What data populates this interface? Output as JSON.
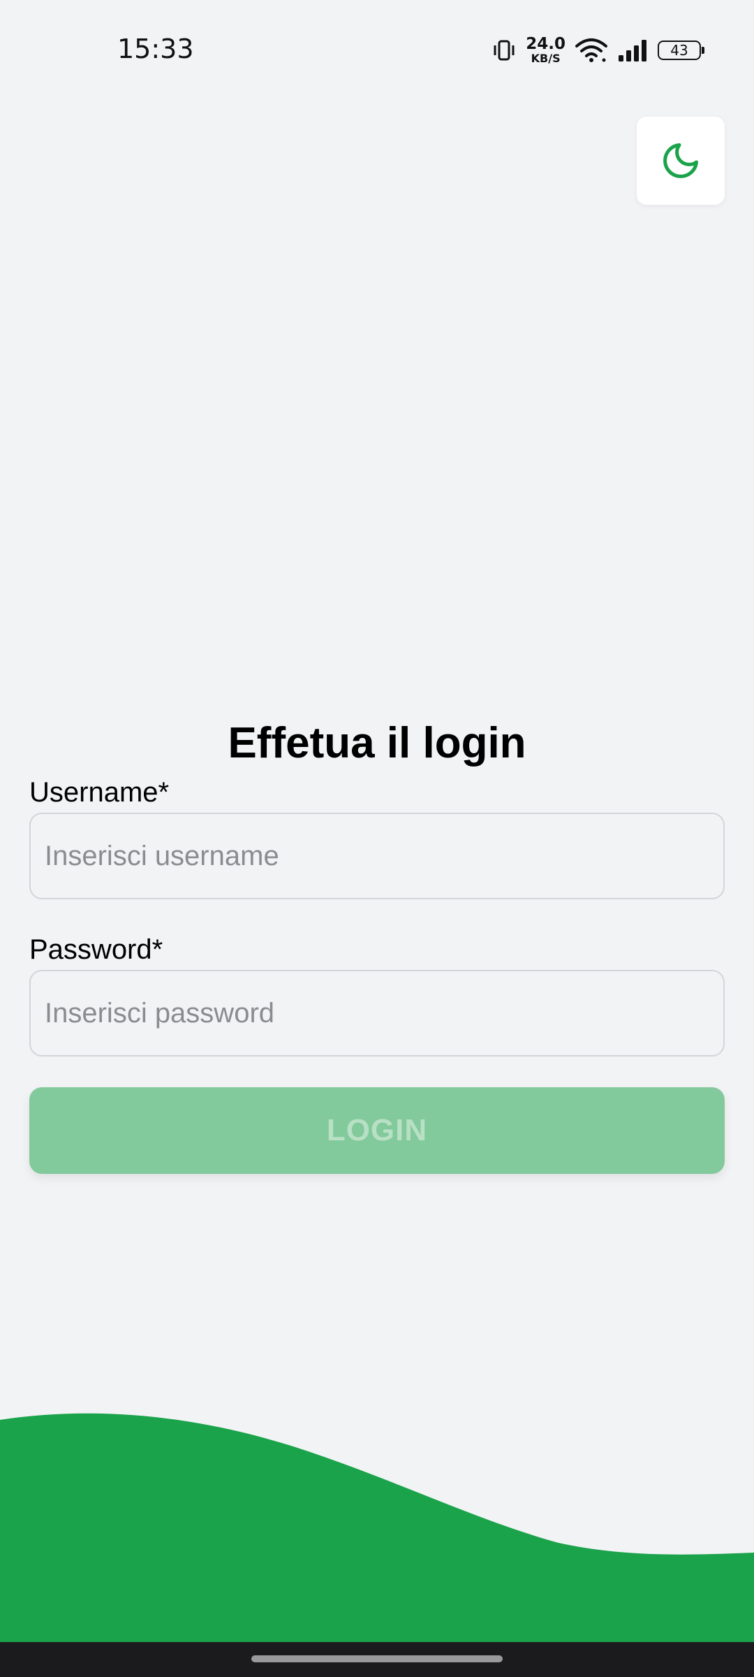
{
  "status_bar": {
    "time": "15:33",
    "net_speed_value": "24.0",
    "net_speed_unit": "KB/S",
    "battery_level": "43",
    "icons": [
      "vibrate-icon",
      "wifi-icon",
      "signal-icon",
      "battery-icon"
    ]
  },
  "theme_toggle": {
    "icon": "moon-icon",
    "accent_color": "#1aa34a"
  },
  "login": {
    "title": "Effetua il login",
    "username_label": "Username*",
    "username_placeholder": "Inserisci username",
    "username_value": "",
    "password_label": "Password*",
    "password_placeholder": "Inserisci password",
    "password_value": "",
    "submit_label": "LOGIN"
  },
  "colors": {
    "background": "#f2f3f5",
    "brand_green": "#1aa34a",
    "button_disabled": "#82c99b"
  }
}
